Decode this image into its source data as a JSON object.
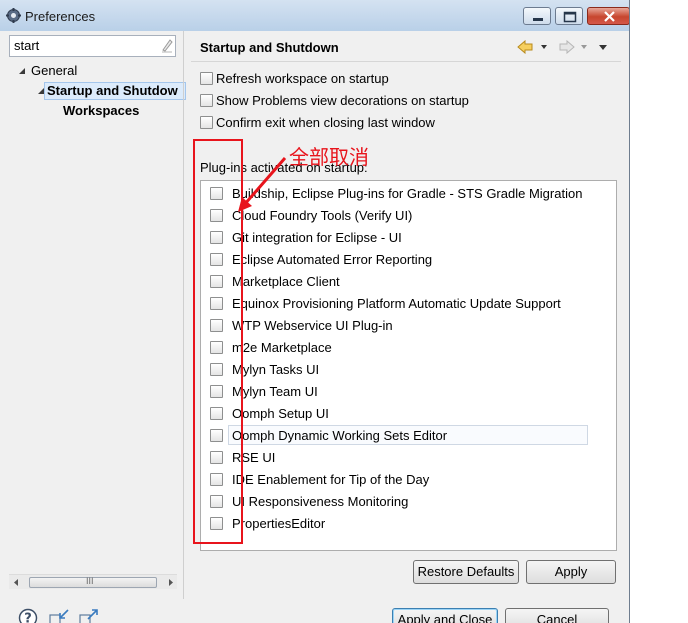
{
  "window": {
    "title": "Preferences"
  },
  "filter": {
    "value": "start"
  },
  "tree": {
    "items": [
      {
        "label": "General"
      },
      {
        "label": "Startup and Shutdow"
      },
      {
        "label": "Workspaces"
      }
    ],
    "hscroll_glyph": "III"
  },
  "page": {
    "title": "Startup and Shutdown",
    "options": [
      {
        "label": "Refresh workspace on startup",
        "checked": false
      },
      {
        "label": "Show Problems view decorations on startup",
        "checked": false
      },
      {
        "label": "Confirm exit when closing last window",
        "checked": false
      }
    ],
    "plugins_caption": "Plug-ins activated on startup:",
    "plugins": [
      {
        "label": "Buildship, Eclipse Plug-ins for Gradle - STS Gradle Migration",
        "checked": false
      },
      {
        "label": "Cloud Foundry Tools (Verify UI)",
        "checked": false
      },
      {
        "label": "Git integration for Eclipse - UI",
        "checked": false
      },
      {
        "label": "Eclipse Automated Error Reporting",
        "checked": false
      },
      {
        "label": "Marketplace Client",
        "checked": false
      },
      {
        "label": "Equinox Provisioning Platform Automatic Update Support",
        "checked": false
      },
      {
        "label": "WTP Webservice UI Plug-in",
        "checked": false
      },
      {
        "label": "m2e Marketplace",
        "checked": false
      },
      {
        "label": "Mylyn Tasks UI",
        "checked": false
      },
      {
        "label": "Mylyn Team UI",
        "checked": false
      },
      {
        "label": "Oomph Setup UI",
        "checked": false
      },
      {
        "label": "Oomph Dynamic Working Sets Editor",
        "checked": false
      },
      {
        "label": "RSE UI",
        "checked": false
      },
      {
        "label": "IDE Enablement for Tip of the Day",
        "checked": false
      },
      {
        "label": "UI Responsiveness Monitoring",
        "checked": false
      },
      {
        "label": "PropertiesEditor",
        "checked": false
      }
    ]
  },
  "buttons": {
    "restore_defaults": "Restore Defaults",
    "apply": "Apply",
    "apply_and_close": "Apply and Close",
    "cancel": "Cancel"
  },
  "annotation": {
    "text": "全部取消",
    "color": "#e8141c"
  },
  "icons": {
    "app": "preferences-gear-icon",
    "back": "back-arrow-icon",
    "forward": "forward-arrow-icon",
    "help": "help-icon",
    "import": "import-icon",
    "export": "export-icon"
  }
}
